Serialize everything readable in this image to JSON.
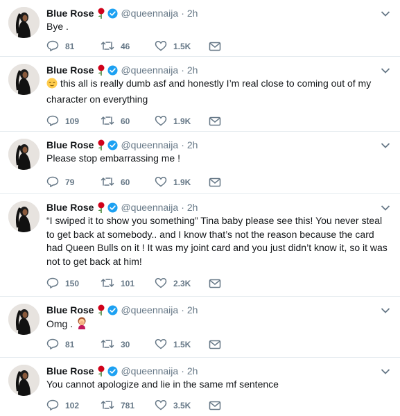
{
  "author": {
    "name": "Blue Rose",
    "handle": "@queennaija",
    "separator": "·",
    "rose_emoji": "rose-icon",
    "verified_icon": "verified-badge-icon"
  },
  "tweets": [
    {
      "time": "2h",
      "text": "Bye .",
      "replies": "81",
      "retweets": "46",
      "likes": "1.5K"
    },
    {
      "time": "2h",
      "emoji": "relieved-face-emoji",
      "text": "this all is really dumb asf and honestly I’m real close to coming out of my character on everything",
      "replies": "109",
      "retweets": "60",
      "likes": "1.9K"
    },
    {
      "time": "2h",
      "text": "Please stop embarrassing me !",
      "replies": "79",
      "retweets": "60",
      "likes": "1.9K"
    },
    {
      "time": "2h",
      "text": "“I swiped it to show you something” Tina baby please see this! You never steal to get back at somebody.. and I know that’s not the reason because the card had Queen Bulls on it ! It was my joint card and you just didn’t know it, so it was not to get back at him!",
      "replies": "150",
      "retweets": "101",
      "likes": "2.3K"
    },
    {
      "time": "2h",
      "text": "Omg .",
      "emoji_after": "woman-facepalming-emoji",
      "replies": "81",
      "retweets": "30",
      "likes": "1.5K"
    },
    {
      "time": "2h",
      "text": "You cannot apologize and lie in the same mf sentence",
      "replies": "102",
      "retweets": "781",
      "likes": "3.5K"
    }
  ],
  "icons": {
    "reply": "reply-icon",
    "retweet": "retweet-icon",
    "like": "heart-icon",
    "dm": "envelope-icon",
    "menu": "chevron-down-icon"
  },
  "colors": {
    "verified": "#1da1f2",
    "rose": "#d0021b",
    "muted": "#657786",
    "divider": "#e6ecf0"
  }
}
